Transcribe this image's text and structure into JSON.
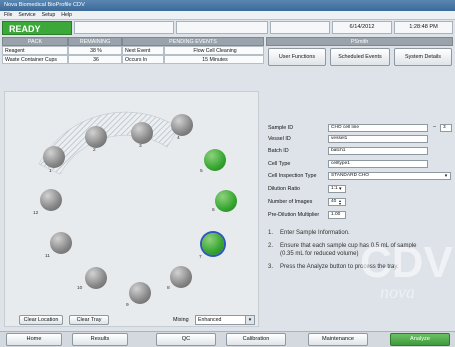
{
  "app": {
    "title": "Nova Biomedical BioProfile CDV"
  },
  "menu": [
    "File",
    "Service",
    "Setup",
    "Help"
  ],
  "status": {
    "ready": "READY"
  },
  "header": {
    "date": "6/14/2012",
    "time": "1:28:48 PM",
    "user": "PSmith"
  },
  "pack_table": {
    "headers": [
      "PACK",
      "REMAINING"
    ],
    "rows": [
      [
        "Reagent",
        "38 %"
      ],
      [
        "Waste Container Cups",
        "36"
      ]
    ]
  },
  "pending": {
    "header": "PENDING EVENTS",
    "rows": [
      [
        "Next Event",
        "Flow Cell Cleaning"
      ],
      [
        "Occurs In",
        "15 Minutes"
      ]
    ]
  },
  "top_buttons": {
    "user_functions": "User Functions",
    "scheduled_events": "Scheduled Events",
    "system_details": "System Details"
  },
  "tray": {
    "cup_numbers": [
      "1",
      "2",
      "3",
      "4",
      "5",
      "6",
      "7",
      "8",
      "9",
      "10",
      "11",
      "12"
    ],
    "clear_location": "Clear Location",
    "clear_tray": "Clear Tray",
    "mixing_label": "Mixing",
    "mixing_value": "Enhanced"
  },
  "form": {
    "sample_id_label": "Sample ID",
    "sample_id_value": "CHO cell line",
    "sample_id_sep": "–",
    "sample_id_num": "3",
    "vessel_id_label": "Vessel ID",
    "vessel_id_value": "vessel1",
    "batch_id_label": "Batch ID",
    "batch_id_value": "batch1",
    "cell_type_label": "Cell Type",
    "cell_type_value": "celltype1",
    "inspection_label": "Cell Inspection Type",
    "inspection_value": "STANDARD CHO",
    "dilution_label": "Dilution Ratio",
    "dilution_value": "1:1",
    "images_label": "Number of Images",
    "images_value": "40",
    "predilution_label": "Pre-Dilution Multiplier",
    "predilution_value": "1.00"
  },
  "instructions": [
    {
      "num": "1.",
      "text": "Enter Sample Information."
    },
    {
      "num": "2.",
      "text": "Ensure that each sample cup has 0.5 mL of sample",
      "text2": "(0.35 mL for reduced volume)"
    },
    {
      "num": "3.",
      "text": "Press the Analyze button to process the tray."
    }
  ],
  "watermark": {
    "big": "CDV",
    "small": "nova"
  },
  "nav": {
    "home": "Home",
    "results": "Results",
    "qc": "QC",
    "calibration": "Calibration",
    "maintenance": "Maintenance",
    "analyze": "Analyze"
  },
  "colors": {
    "ready_green": "#3da83a",
    "analyze_green": "#4fae49",
    "title_blue": "#4675a5"
  }
}
